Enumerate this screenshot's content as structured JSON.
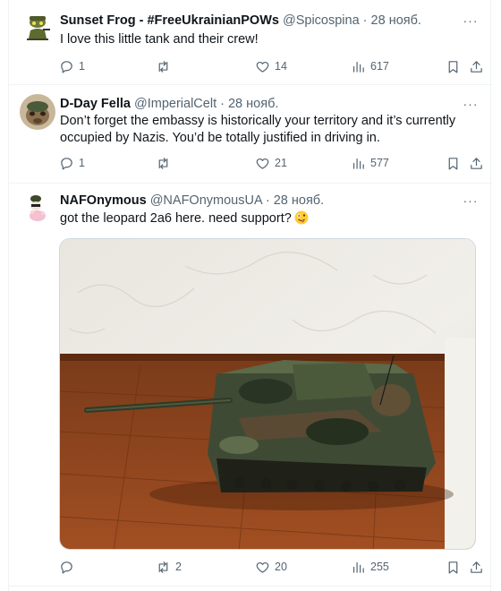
{
  "tweets": [
    {
      "author": "Sunset Frog - #FreeUkrainianPOWs",
      "handle": "@Spicospina",
      "sep": " · ",
      "date": "28 нояб.",
      "text": "I love this little tank and their crew!",
      "replies": "1",
      "retweets": "",
      "likes": "14",
      "views": "617"
    },
    {
      "author": "D-Day Fella",
      "handle": "@ImperialCelt",
      "sep": " · ",
      "date": "28 нояб.",
      "text": "Don’t forget the embassy is historically your territory and it’s currently occupied by Nazis. You’d be totally justified in driving in.",
      "replies": "1",
      "retweets": "",
      "likes": "21",
      "views": "577"
    },
    {
      "author": "NAFOnymous",
      "handle": "@NAFOnymousUA",
      "sep": " · ",
      "date": "28 нояб.",
      "text": "got the leopard 2a6 here. need support?",
      "replies": "",
      "retweets": "2",
      "likes": "20",
      "views": "255"
    }
  ],
  "more_glyph": "···",
  "icons": [
    "reply-icon",
    "retweet-icon",
    "like-icon",
    "views-icon",
    "bookmark-icon",
    "share-icon",
    "more-icon"
  ],
  "colors": {
    "text": "#0f1419",
    "secondary": "#536471",
    "divider": "#eff3f4"
  }
}
